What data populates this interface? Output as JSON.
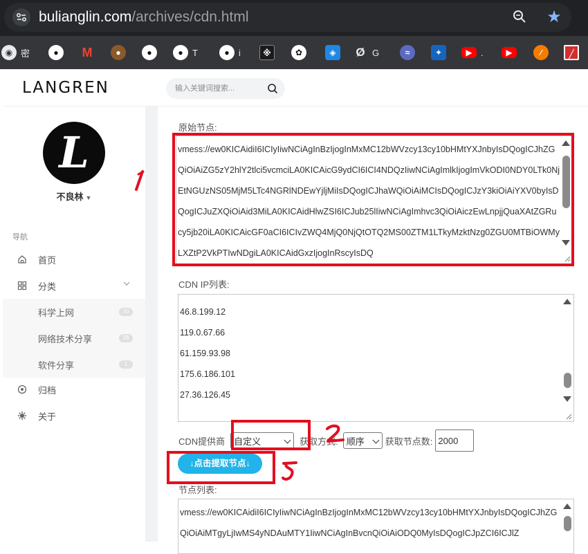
{
  "browser": {
    "url_host": "bulianglin.com",
    "url_path": "/archives/cdn.html",
    "bookmarks": [
      {
        "icon": "chrome-icon",
        "label": "密",
        "color": "#5f6368"
      },
      {
        "icon": "github-icon",
        "label": "",
        "color": "#ffffff"
      },
      {
        "icon": "gmail-icon",
        "label": "",
        "color": "#ea4335"
      },
      {
        "icon": "avatar-icon",
        "label": "",
        "color": "#8b5a2b"
      },
      {
        "icon": "github-icon",
        "label": "",
        "color": "#ffffff"
      },
      {
        "icon": "github-icon",
        "label": "T",
        "color": "#ffffff"
      },
      {
        "icon": "github-icon",
        "label": "i",
        "color": "#ffffff"
      },
      {
        "icon": "tool-icon",
        "label": "",
        "color": "#1a1a1a"
      },
      {
        "icon": "openai-icon",
        "label": "",
        "color": "#ffffff"
      },
      {
        "icon": "box-icon",
        "label": "",
        "color": "#1e88e5"
      },
      {
        "icon": "slash-icon",
        "label": "G",
        "color": "#9e9e9e"
      },
      {
        "icon": "bird-icon",
        "label": "",
        "color": "#5c6bc0"
      },
      {
        "icon": "butterfly-icon",
        "label": "",
        "color": "#1565c0"
      },
      {
        "icon": "youtube-icon",
        "label": ".",
        "color": "#ff0000"
      },
      {
        "icon": "youtube-icon",
        "label": "",
        "color": "#ff0000"
      },
      {
        "icon": "ball-icon",
        "label": "",
        "color": "#f57c00"
      },
      {
        "icon": "chart-icon",
        "label": "",
        "color": "#d32f2f"
      }
    ]
  },
  "header": {
    "logo": "LANGREN",
    "search_placeholder": "输入关键词搜索..."
  },
  "sidebar": {
    "user_name": "不良林",
    "avatar_letter": "L",
    "nav_title": "导航",
    "items": [
      {
        "label": "首页",
        "icon": "home-icon"
      },
      {
        "label": "分类",
        "icon": "grid-icon"
      }
    ],
    "sub_items": [
      {
        "label": "科学上网",
        "badge": "70"
      },
      {
        "label": "网络技术分享",
        "badge": "28"
      },
      {
        "label": "软件分享",
        "badge": "1"
      }
    ],
    "items_bottom": [
      {
        "label": "归档",
        "icon": "archive-icon"
      },
      {
        "label": "关于",
        "icon": "about-icon"
      }
    ]
  },
  "form": {
    "original_label": "原始节点:",
    "original_text": "vmess://ew0KICAidiI6ICIyIiwNCiAgInBzIjogInMxMC12bWVzcy13cy10bHMtYXJnbyIsDQogICJhZGQiOiAiZG5zY2hlY2tlci5vcmciLA0KICAicG9ydCI6ICI4NDQzIiwNCiAgImlkIjogImVkODI0NDY0LTk0NjEtNGUzNS05MjM5LTc4NGRlNDEwYjljMiIsDQogICJhaWQiOiAiMCIsDQogICJzY3kiOiAiYXV0byIsDQogICJuZXQiOiAid3MiLA0KICAidHlwZSI6ICJub25lIiwNCiAgImhvc3QiOiAiczEwLnpjjQuaXAtZGRucy5jb20iLA0KICAicGF0aCI6ICIvZWQ4MjQ0NjQtOTQ2MS00ZTM1LTkyMzktNzg0ZGU0MTBiOWMyLXZtP2VkPTIwNDgiLA0KICAidGxzIjogInRscyIsDQ",
    "cdn_ip_label": "CDN IP列表:",
    "cdn_ips": [
      "46.8.199.12",
      "119.0.67.66",
      "61.159.93.98",
      "175.6.186.101",
      "27.36.126.45"
    ],
    "provider_label": "CDN提供商",
    "provider_value": "自定义",
    "method_label": "获取方式:",
    "method_value": "顺序",
    "count_label": "获取节点数:",
    "count_value": "2000",
    "extract_button": "↓点击提取节点↓",
    "node_list_label": "节点列表:",
    "node_list_text": "vmess://ew0KICAidiI6ICIyIiwNCiAgInBzIjogInMxMC12bWVzcy13cy10bHMtYXJnbyIsDQogICJhZGQiOiAiMTgyLjIwMS4yNDAuMTY1IiwNCiAgInBvcnQiOiAiODQ0MyIsDQogICJpZCI6ICJlZ"
  },
  "colors": {
    "annotation_red": "#e30e1f",
    "button_blue": "#21b3e9"
  }
}
